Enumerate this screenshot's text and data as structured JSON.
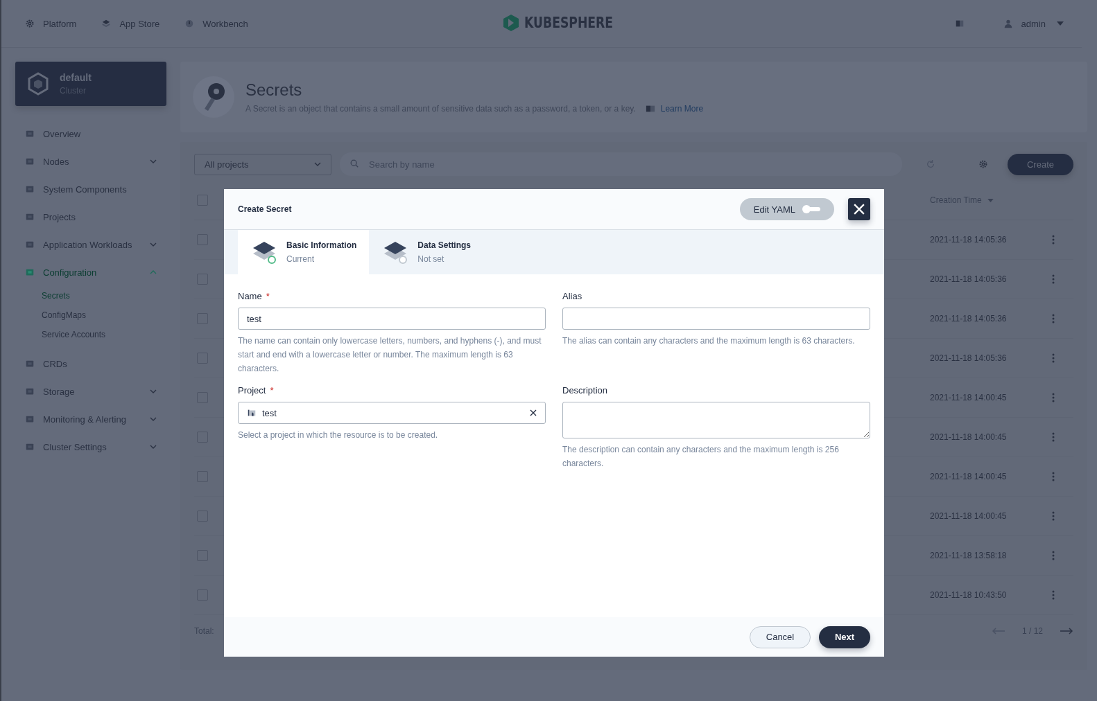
{
  "top_nav": {
    "items": [
      {
        "label": "Platform",
        "kind": "gear"
      },
      {
        "label": "App Store",
        "kind": "layers"
      },
      {
        "label": "Workbench",
        "kind": "dial"
      }
    ],
    "logo": "KUBESPHERE",
    "user": "admin"
  },
  "sidebar": {
    "cluster": {
      "name": "default",
      "subtitle": "Cluster"
    },
    "items": [
      {
        "label": "Overview",
        "kind": "link",
        "selected": false
      },
      {
        "label": "Nodes",
        "kind": "group",
        "expanded": false,
        "selected": false
      },
      {
        "label": "System Components",
        "kind": "link",
        "selected": false
      },
      {
        "label": "Projects",
        "kind": "link",
        "selected": false
      },
      {
        "label": "Application Workloads",
        "kind": "group",
        "expanded": false,
        "selected": false
      },
      {
        "label": "Configuration",
        "kind": "group",
        "expanded": true,
        "selected": true,
        "children": [
          {
            "label": "Secrets",
            "selected": true
          },
          {
            "label": "ConfigMaps",
            "selected": false
          },
          {
            "label": "Service Accounts",
            "selected": false
          }
        ]
      },
      {
        "label": "CRDs",
        "kind": "link",
        "selected": false
      },
      {
        "label": "Storage",
        "kind": "group",
        "expanded": false,
        "selected": false
      },
      {
        "label": "Monitoring & Alerting",
        "kind": "group",
        "expanded": false,
        "selected": false
      },
      {
        "label": "Cluster Settings",
        "kind": "group",
        "expanded": false,
        "selected": false
      }
    ]
  },
  "page_header": {
    "title": "Secrets",
    "description": "A Secret is an object that contains a small amount of sensitive data such as a password, a token, or a key.",
    "link": "Learn More"
  },
  "toolbar": {
    "project_filter": "All projects",
    "search": {
      "placeholder": "Search by name"
    },
    "create_button": "Create"
  },
  "table": {
    "select_all_checked": false,
    "columns": [
      {
        "label": "Creation Time"
      }
    ],
    "rows": [
      {
        "time": "2021-11-18 14:05:36",
        "checked": false
      },
      {
        "time": "2021-11-18 14:05:36",
        "checked": false
      },
      {
        "time": "2021-11-18 14:05:36",
        "checked": false
      },
      {
        "time": "2021-11-18 14:05:36",
        "checked": false
      },
      {
        "time": "2021-11-18 14:00:45",
        "checked": false
      },
      {
        "time": "2021-11-18 14:00:45",
        "checked": false
      },
      {
        "time": "2021-11-18 14:00:45",
        "checked": false
      },
      {
        "time": "2021-11-18 14:00:45",
        "checked": false
      },
      {
        "time": "2021-11-18 13:58:18",
        "checked": false
      },
      {
        "time": "2021-11-18 10:43:50",
        "checked": false
      }
    ],
    "total": "Total:",
    "pagination": "1 / 12"
  },
  "dialog": {
    "title": "Create Secret",
    "edit_yaml": {
      "label": "Edit YAML",
      "on": false
    },
    "steps": [
      {
        "title": "Basic Information",
        "status": "Current",
        "selected": true
      },
      {
        "title": "Data Settings",
        "status": "Not set",
        "selected": false
      }
    ],
    "fields": [
      {
        "label": "Name",
        "required_mark": "*",
        "kind": "text",
        "value": "test",
        "hint": "The name can contain only lowercase letters, numbers, and hyphens (-), and must start and end with a lowercase letter or number. The maximum length is 63 characters."
      },
      {
        "label": "Alias",
        "kind": "text",
        "hint": "The alias can contain any characters and the maximum length is 63 characters."
      },
      {
        "label": "Project",
        "required_mark": "*",
        "kind": "select",
        "value": "test",
        "hint": "Select a project in which the resource is to be created."
      },
      {
        "label": "Description",
        "kind": "textarea",
        "hint": "The description can contain any characters and the maximum length is 256 characters."
      }
    ],
    "cancel_button": "Cancel",
    "next_button": "Next"
  }
}
